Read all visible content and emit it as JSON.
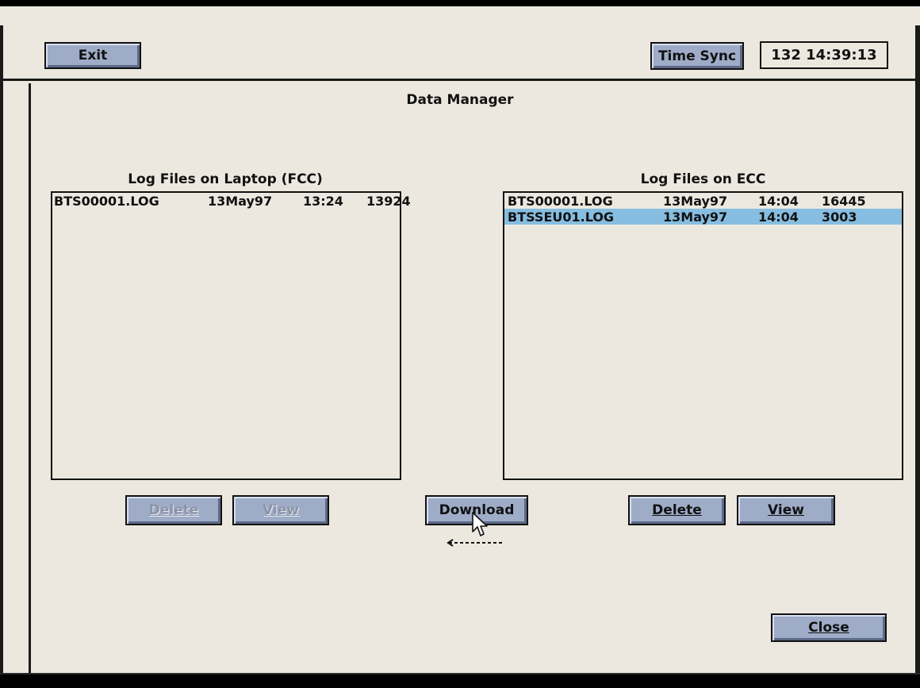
{
  "toolbar": {
    "exit_label": "Exit",
    "time_sync_label": "Time Sync",
    "clock_value": "132 14:39:13"
  },
  "window": {
    "title": "Data Manager"
  },
  "laptop_panel": {
    "label": "Log Files on Laptop (FCC)",
    "files": [
      {
        "name": "BTS00001.LOG",
        "date": "13May97",
        "time": "13:24",
        "size": "13924"
      }
    ],
    "delete_label": "Delete",
    "view_label": "View"
  },
  "ecc_panel": {
    "label": "Log Files on ECC",
    "files": [
      {
        "name": "BTS00001.LOG",
        "date": "13May97",
        "time": "14:04",
        "size": "16445"
      },
      {
        "name": "BTSSEU01.LOG",
        "date": "13May97",
        "time": "14:04",
        "size": "3003"
      }
    ],
    "delete_label": "Delete",
    "view_label": "View"
  },
  "actions": {
    "download_label": "Download",
    "close_label": "Close"
  },
  "colors": {
    "button_face": "#9eacc8",
    "background": "#ece8df",
    "selection": "#86bde0"
  },
  "icons": [
    "arrow-pointer-cursor-icon",
    "left-dashed-arrow-icon"
  ]
}
